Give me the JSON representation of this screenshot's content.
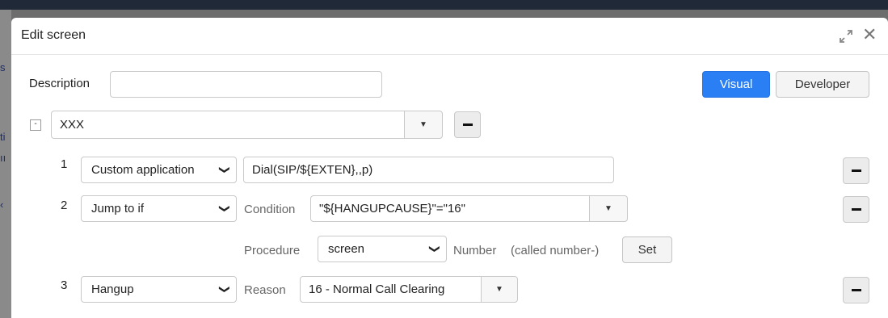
{
  "dialog": {
    "title": "Edit screen",
    "icons": {
      "expand": "expand-icon",
      "close": "close-icon"
    }
  },
  "background": {
    "fragments": [
      "s",
      "ti",
      "ıı",
      "‹"
    ]
  },
  "header": {
    "description_label": "Description",
    "description_value": "",
    "mode_visual": "Visual",
    "mode_developer": "Developer"
  },
  "screen_select": {
    "toggle": "-",
    "value": "XXX"
  },
  "steps": [
    {
      "number": "1",
      "action": "Custom application",
      "argument": "Dial(SIP/${EXTEN},,p)"
    },
    {
      "number": "2",
      "action": "Jump to if",
      "condition_label": "Condition",
      "condition_value": "\"${HANGUPCAUSE}\"=\"16\"",
      "procedure_label": "Procedure",
      "procedure_value": "screen",
      "number_label": "Number",
      "number_hint": "(called number-)",
      "set_label": "Set"
    },
    {
      "number": "3",
      "action": "Hangup",
      "reason_label": "Reason",
      "reason_value": "16 - Normal Call Clearing"
    }
  ],
  "colors": {
    "primary": "#2b7ff5",
    "topbar": "#1f2937",
    "overlay": "#6d6d6d"
  }
}
